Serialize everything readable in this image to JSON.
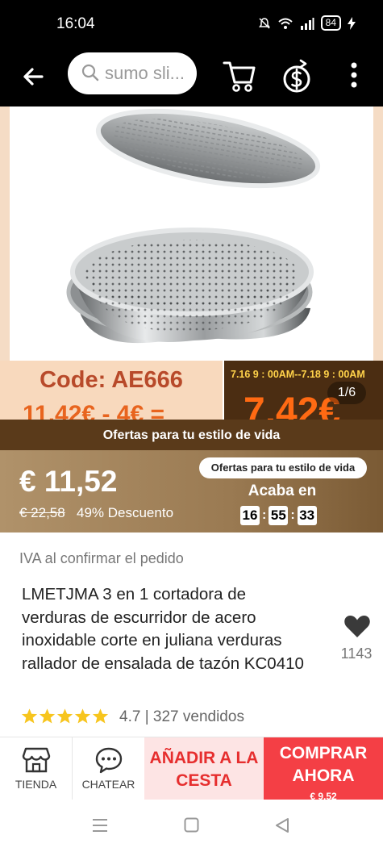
{
  "status_bar": {
    "time": "16:04",
    "battery": "84"
  },
  "header": {
    "search_placeholder": "sumo sli..."
  },
  "gallery": {
    "banner_code": "Code: AE666",
    "banner_old_price": "11,42€ - 4€ =",
    "banner_dates": "7.16 9 : 00AM--7.18 9 : 00AM",
    "banner_new_price": "7,42€",
    "counter": "1/6"
  },
  "promo": {
    "strip_label": "Ofertas para tu estilo de vida",
    "pill_label": "Ofertas para tu estilo de vida",
    "current_price": "€ 11,52",
    "old_price": "€ 22,58",
    "discount": "49% Descuento",
    "ends_label": "Acaba en",
    "timer": {
      "hours": "16",
      "minutes": "55",
      "seconds": "33"
    }
  },
  "product": {
    "vat_note": "IVA al confirmar el pedido",
    "title": "LMETJMA 3 en 1 cortadora de verduras de escurridor de acero inoxidable corte en juliana verduras rallador de ensalada de tazón KC0410",
    "likes": "1143",
    "rating": 4.7,
    "rating_text": "4.7 | 327 vendidos"
  },
  "bottom_bar": {
    "store_label": "TIENDA",
    "chat_label": "CHATEAR",
    "add_to_cart_label": "AÑADIR A LA CESTA",
    "buy_now_label": "COMPRAR AHORA",
    "buy_now_price": "€ 9,52"
  },
  "colors": {
    "accent_red": "#f43f45",
    "add_cart_bg": "#fde4e4",
    "star_yellow": "#f7c51e",
    "promo_brown": "#5a3a1a"
  },
  "icons": {
    "back": "arrow-left-icon",
    "search": "search-icon",
    "cart": "cart-icon",
    "coin": "dollar-coin-icon",
    "more": "more-vertical-icon",
    "like": "heart-icon",
    "store": "store-icon",
    "chat": "chat-bubble-icon"
  }
}
